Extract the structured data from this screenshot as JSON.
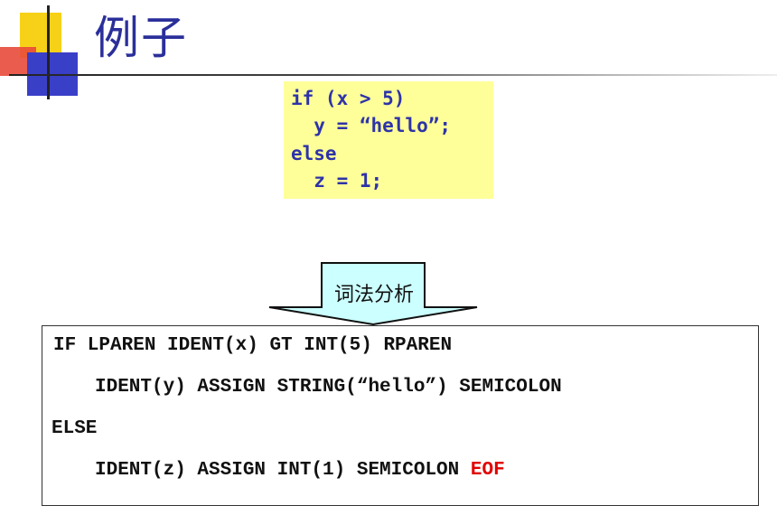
{
  "slide": {
    "title": "例子"
  },
  "source_code": {
    "lines": [
      "if (x > 5)",
      "  y = “hello”;",
      "else",
      "  z = 1;"
    ]
  },
  "arrow": {
    "label": "词法分析"
  },
  "tokens": {
    "line1": "IF LPAREN IDENT(x) GT INT(5) RPAREN",
    "line2": "IDENT(y) ASSIGN STRING(“hello”) SEMICOLON",
    "line3": "ELSE",
    "line4": "IDENT(z) ASSIGN INT(1) SEMICOLON ",
    "line4_eof": "EOF"
  },
  "colors": {
    "title": "#2b2f9a",
    "code_bg": "#ffff99",
    "code_text": "#2e33a8",
    "arrow_fill": "#ccffff",
    "eof": "#e00000"
  }
}
